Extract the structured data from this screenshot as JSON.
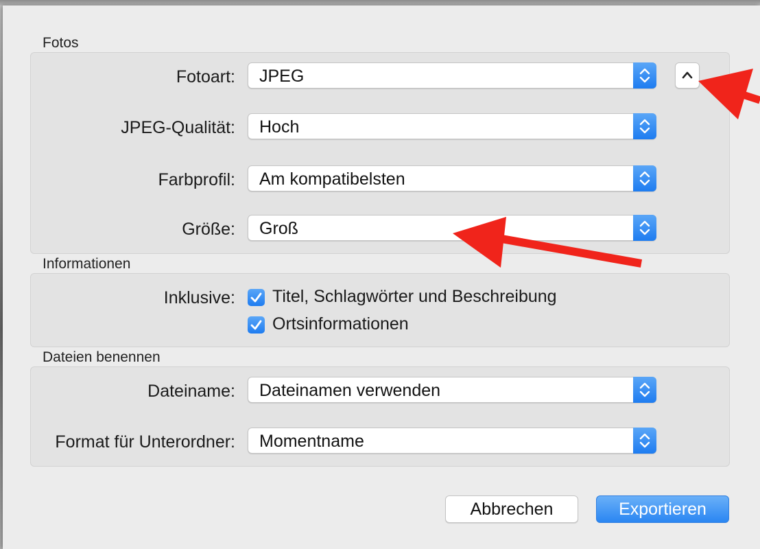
{
  "sections": {
    "fotos": {
      "title": "Fotos",
      "rows": [
        {
          "label": "Fotoart:",
          "value": "JPEG"
        },
        {
          "label": "JPEG-Qualität:",
          "value": "Hoch"
        },
        {
          "label": "Farbprofil:",
          "value": "Am kompatibelsten"
        },
        {
          "label": "Größe:",
          "value": "Groß"
        }
      ]
    },
    "informationen": {
      "title": "Informationen",
      "label": "Inklusive:",
      "checkboxes": [
        {
          "label": "Titel, Schlagwörter und Beschreibung",
          "checked": true
        },
        {
          "label": "Ortsinformationen",
          "checked": true
        }
      ]
    },
    "dateien": {
      "title": "Dateien benennen",
      "rows": [
        {
          "label": "Dateiname:",
          "value": "Dateinamen verwenden"
        },
        {
          "label": "Format für Unterordner:",
          "value": "Momentname"
        }
      ]
    }
  },
  "buttons": {
    "cancel": "Abbrechen",
    "export": "Exportieren"
  },
  "icons": {
    "stepper": "chevron-up-down-icon",
    "collapse": "chevron-up-icon",
    "checkmark": "checkmark-icon",
    "annotation": "red-arrow-icon"
  },
  "colors": {
    "accent": "#1e7cf0",
    "annotation": "#f0241b"
  }
}
